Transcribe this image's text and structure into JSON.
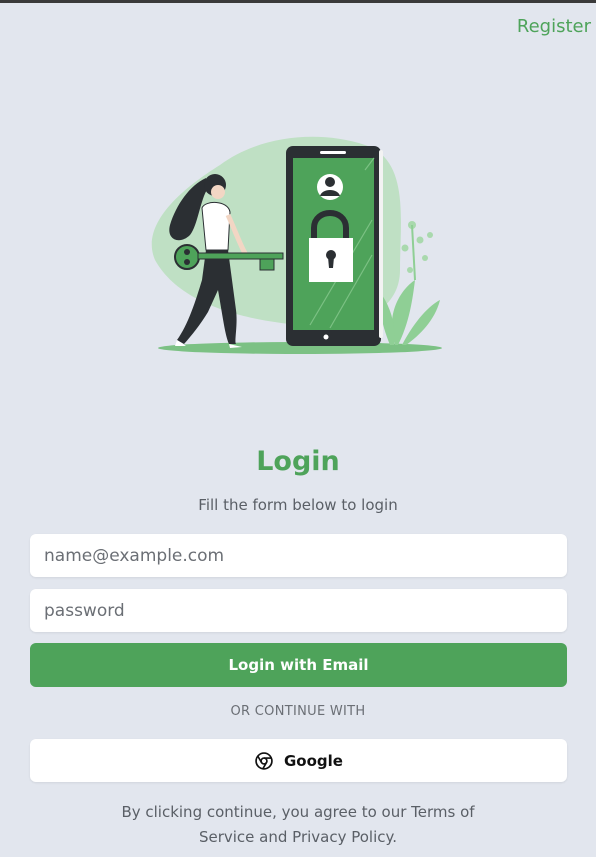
{
  "header": {
    "register_label": "Register"
  },
  "login": {
    "title": "Login",
    "subtitle": "Fill the form below to login",
    "email_placeholder": "name@example.com",
    "password_placeholder": "password",
    "submit_label": "Login with Email",
    "divider_text": "OR CONTINUE WITH",
    "google_label": "Google",
    "terms_text": "By clicking continue, you agree to our Terms of Service and Privacy Policy."
  },
  "colors": {
    "accent": "#4ea35a",
    "background": "#e2e6ee",
    "phone": "#2b2f33"
  },
  "icons": {
    "google": "chrome-icon",
    "illustration": "security-key-illustration"
  }
}
